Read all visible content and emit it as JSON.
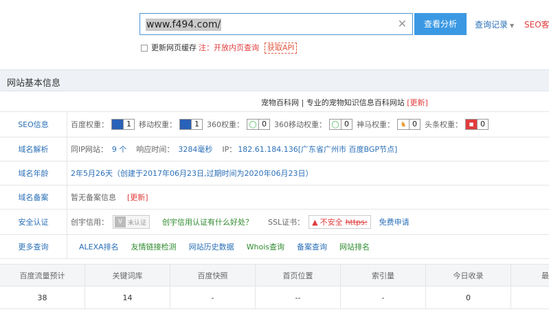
{
  "search": {
    "url": "www.f494.com/",
    "button": "查看分析",
    "history": "查询记录",
    "seo_client": "SEO客户",
    "cache_label": "更新网页缓存",
    "note": "注：开放内页查询",
    "api": "获取API"
  },
  "panel": {
    "title": "网站基本信息",
    "site_desc": "宠物百科网 | 专业的宠物知识信息百科网站",
    "update": "[更新]"
  },
  "seo": {
    "label": "SEO信息",
    "items": [
      {
        "name": "百度权重：",
        "icon": "paw-icon",
        "value": "1"
      },
      {
        "name": "移动权重：",
        "icon": "paw-icon",
        "value": "1"
      },
      {
        "name": "360权重：",
        "icon": "360-icon",
        "value": "0"
      },
      {
        "name": "360移动权重：",
        "icon": "360-icon",
        "value": "0"
      },
      {
        "name": "神马权重：",
        "icon": "shenma-icon",
        "value": "0"
      },
      {
        "name": "头条权重：",
        "icon": "toutiao-icon",
        "value": "0"
      }
    ]
  },
  "domain": {
    "label": "域名解析",
    "same_ip_label": "同IP网站：",
    "same_ip_value": "9 个",
    "response_label": "响应时间：",
    "response_value": "3284毫秒",
    "ip_label": "IP：",
    "ip_value": "182.61.184.136[广东省广州市 百度BGP节点]"
  },
  "age": {
    "label": "域名年龄",
    "value": "2年5月26天（创建于2017年06月23日,过期时间为2020年06月23日）"
  },
  "beian": {
    "label": "域名备案",
    "value": "暂无备案信息",
    "update": "[更新]"
  },
  "security": {
    "label": "安全认证",
    "credit_label": "创宇信用：",
    "cert_text": "未认证",
    "benefit_link": "创宇信用认证有什么好处？",
    "ssl_label": "SSL证书：",
    "unsafe_text": "不安全",
    "https_text": "https:",
    "free_apply": "免费申请"
  },
  "more": {
    "label": "更多查询",
    "links": [
      "ALEXA排名",
      "友情链接检测",
      "网站历史数据",
      "Whois查询",
      "备案查询",
      "网站排名"
    ]
  },
  "stats": {
    "headers": [
      "百度流量预计",
      "关键词库",
      "百度快照",
      "首页位置",
      "索引量",
      "今日收录",
      "最"
    ],
    "values": [
      "38",
      "14",
      "-",
      "--",
      "-",
      "0",
      ""
    ]
  },
  "colors": {
    "accent": "#3b99e3",
    "link": "#2a6fb7",
    "green": "#2e8b2e",
    "red": "#e13c3c"
  }
}
